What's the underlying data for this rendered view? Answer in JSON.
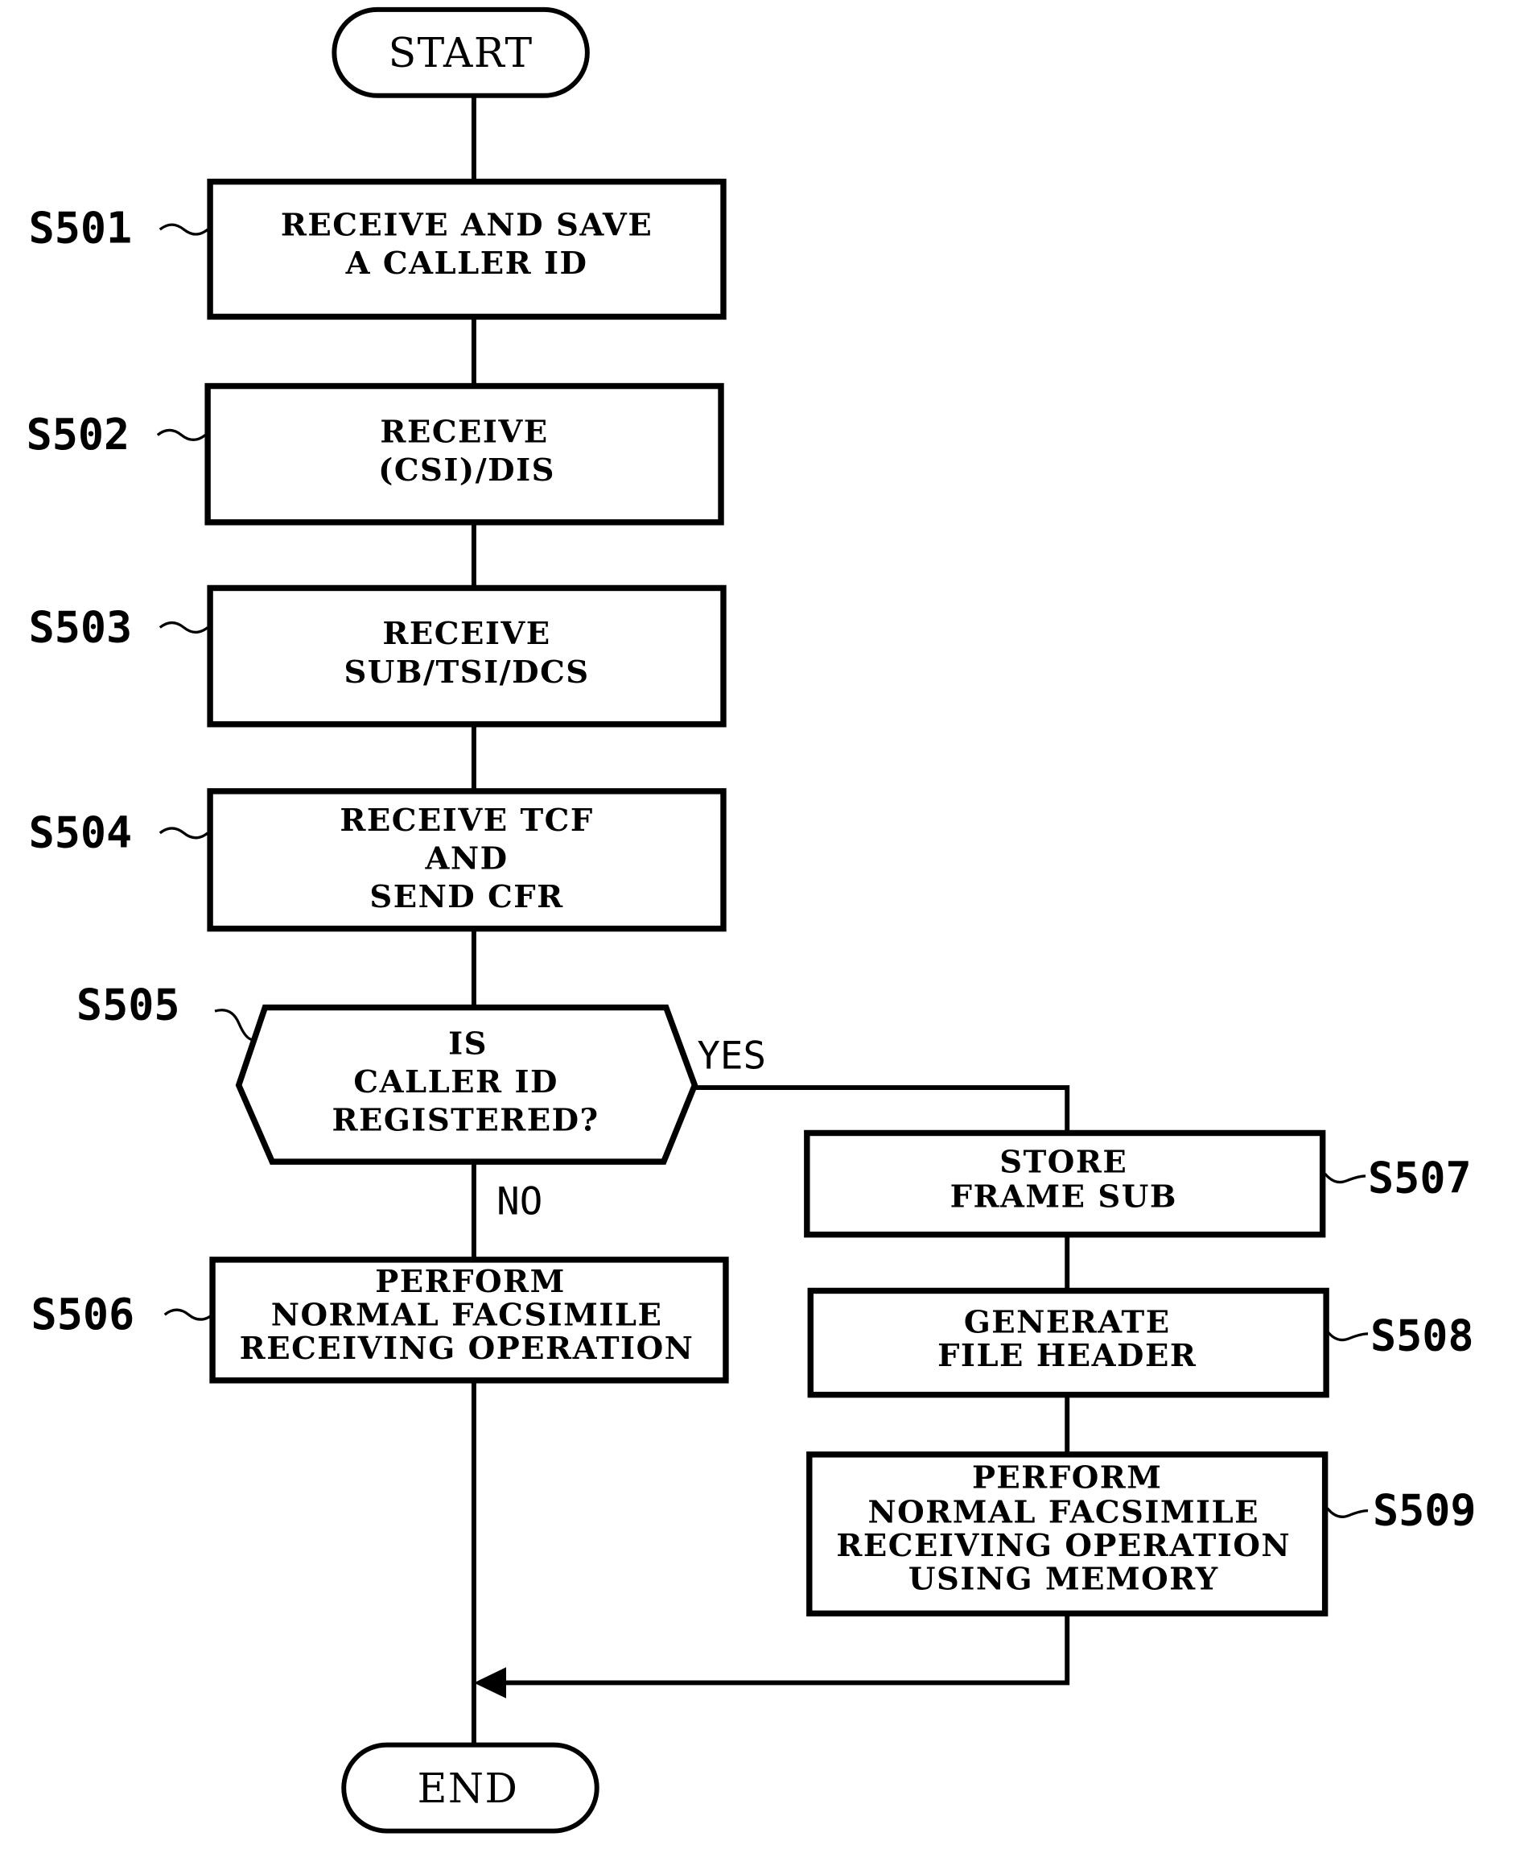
{
  "diagram": {
    "type": "flowchart",
    "start": {
      "label": "START"
    },
    "end": {
      "label": "END"
    },
    "steps": [
      {
        "id": "S501",
        "lines": [
          "RECEIVE AND SAVE",
          "A CALLER ID"
        ]
      },
      {
        "id": "S502",
        "lines": [
          "RECEIVE",
          "(CSI)/DIS"
        ]
      },
      {
        "id": "S503",
        "lines": [
          "RECEIVE",
          "SUB/TSI/DCS"
        ]
      },
      {
        "id": "S504",
        "lines": [
          "RECEIVE TCF",
          "AND",
          "SEND CFR"
        ]
      },
      {
        "id": "S505",
        "kind": "decision",
        "lines": [
          "IS",
          "CALLER ID",
          "REGISTERED?"
        ]
      },
      {
        "id": "S506",
        "lines": [
          "PERFORM",
          "NORMAL FACSIMILE",
          "RECEIVING OPERATION"
        ]
      },
      {
        "id": "S507",
        "lines": [
          "STORE",
          "FRAME SUB"
        ]
      },
      {
        "id": "S508",
        "lines": [
          "GENERATE",
          "FILE HEADER"
        ]
      },
      {
        "id": "S509",
        "lines": [
          "PERFORM",
          "NORMAL FACSIMILE",
          "RECEIVING OPERATION",
          "USING MEMORY"
        ]
      }
    ],
    "branches": {
      "yes": "YES",
      "no": "NO"
    }
  }
}
